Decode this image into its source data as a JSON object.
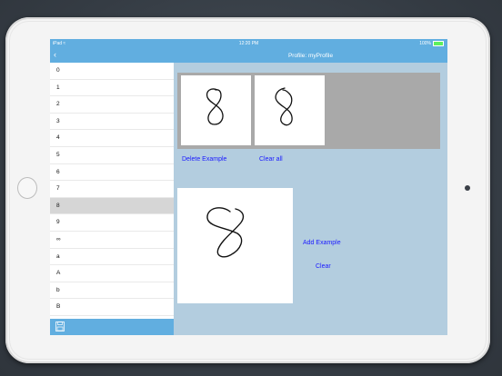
{
  "status_bar": {
    "device": "iPad",
    "time": "12:20 PM",
    "battery": "100%"
  },
  "sidebar": {
    "items": [
      {
        "label": "0"
      },
      {
        "label": "1"
      },
      {
        "label": "2"
      },
      {
        "label": "3"
      },
      {
        "label": "4"
      },
      {
        "label": "5"
      },
      {
        "label": "6"
      },
      {
        "label": "7"
      },
      {
        "label": "8",
        "selected": true
      },
      {
        "label": "9"
      },
      {
        "label": "∞"
      },
      {
        "label": "a"
      },
      {
        "label": "A"
      },
      {
        "label": "b"
      },
      {
        "label": "B"
      }
    ]
  },
  "main": {
    "title": "Profile: myProfile",
    "delete_example_label": "Delete Example",
    "clear_all_label": "Clear all",
    "add_example_label": "Add Example",
    "clear_label": "Clear"
  },
  "icons": {
    "back": "chevron-left-icon",
    "save": "floppy-disk-icon",
    "wifi": "wifi-icon",
    "battery": "battery-icon"
  },
  "colors": {
    "nav_bar": "#61aee0",
    "main_background": "#b3cddf",
    "examples_strip": "#a9a9a9",
    "selected_row": "#d6d6d6",
    "link_text": "#1b1bff"
  }
}
